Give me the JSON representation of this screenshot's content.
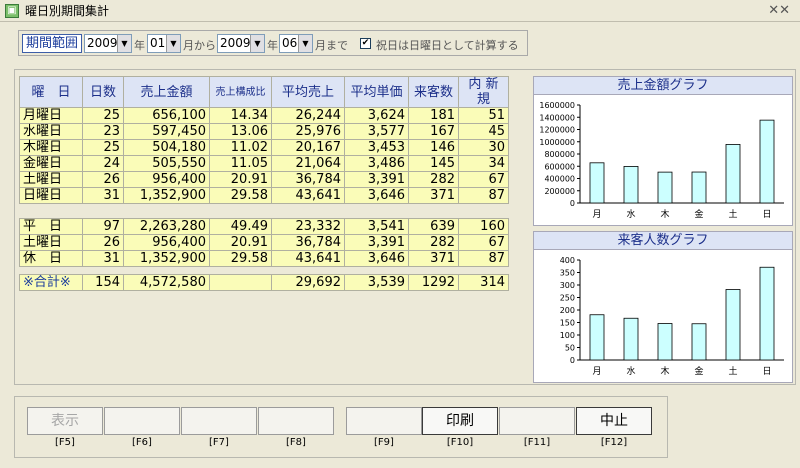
{
  "window": {
    "title": "曜日別期間集計",
    "close": "✕✕"
  },
  "period": {
    "label": "期間範囲",
    "from_year": "2009",
    "year_unit": "年",
    "from_month": "01",
    "from_unit": "月から",
    "to_year": "2009",
    "to_month": "06",
    "to_unit": "月まで",
    "holiday_checkbox": "✔",
    "holiday_label": "祝日は日曜日として計算する"
  },
  "table": {
    "headers": [
      "曜　日",
      "日数",
      "売上金額",
      "売上構成比",
      "平均売上",
      "平均単価",
      "来客数",
      "内 新規"
    ],
    "weekday_rows": [
      [
        "月曜日",
        "25",
        "656,100",
        "14.34",
        "26,244",
        "3,624",
        "181",
        "51"
      ],
      [
        "水曜日",
        "23",
        "597,450",
        "13.06",
        "25,976",
        "3,577",
        "167",
        "45"
      ],
      [
        "木曜日",
        "25",
        "504,180",
        "11.02",
        "20,167",
        "3,453",
        "146",
        "30"
      ],
      [
        "金曜日",
        "24",
        "505,550",
        "11.05",
        "21,064",
        "3,486",
        "145",
        "34"
      ],
      [
        "土曜日",
        "26",
        "956,400",
        "20.91",
        "36,784",
        "3,391",
        "282",
        "67"
      ],
      [
        "日曜日",
        "31",
        "1,352,900",
        "29.58",
        "43,641",
        "3,646",
        "371",
        "87"
      ]
    ],
    "group_rows": [
      [
        "平　日",
        "97",
        "2,263,280",
        "49.49",
        "23,332",
        "3,541",
        "639",
        "160"
      ],
      [
        "土曜日",
        "26",
        "956,400",
        "20.91",
        "36,784",
        "3,391",
        "282",
        "67"
      ],
      [
        "休　日",
        "31",
        "1,352,900",
        "29.58",
        "43,641",
        "3,646",
        "371",
        "87"
      ]
    ],
    "total_row": [
      "※合計※",
      "154",
      "4,572,580",
      "",
      "29,692",
      "3,539",
      "1292",
      "314"
    ]
  },
  "chart_data": [
    {
      "type": "bar",
      "title": "売上金額グラフ",
      "categories": [
        "月",
        "水",
        "木",
        "金",
        "土",
        "日"
      ],
      "values": [
        656100,
        597450,
        504180,
        505550,
        956400,
        1352900
      ],
      "ylim": [
        0,
        1600000
      ],
      "yticks": [
        "0",
        "200000",
        "400000",
        "600000",
        "800000",
        "1000000",
        "1200000",
        "1400000",
        "1600000"
      ],
      "color": "#ccffff"
    },
    {
      "type": "bar",
      "title": "来客人数グラフ",
      "categories": [
        "月",
        "水",
        "木",
        "金",
        "土",
        "日"
      ],
      "values": [
        181,
        167,
        146,
        145,
        282,
        371
      ],
      "ylim": [
        0,
        400
      ],
      "yticks": [
        "0",
        "50",
        "100",
        "150",
        "200",
        "250",
        "300",
        "350",
        "400"
      ],
      "color": "#ccffff"
    }
  ],
  "buttons": [
    {
      "label": "表示",
      "key": "[F5]",
      "state": "disabled"
    },
    {
      "label": "",
      "key": "[F6]",
      "state": "disabled"
    },
    {
      "label": "",
      "key": "[F7]",
      "state": "disabled"
    },
    {
      "label": "",
      "key": "[F8]",
      "state": "disabled"
    },
    {
      "label": "",
      "key": "[F9]",
      "state": "disabled"
    },
    {
      "label": "印刷",
      "key": "[F10]",
      "state": "active"
    },
    {
      "label": "",
      "key": "[F11]",
      "state": "disabled"
    },
    {
      "label": "中止",
      "key": "[F12]",
      "state": "active"
    }
  ]
}
